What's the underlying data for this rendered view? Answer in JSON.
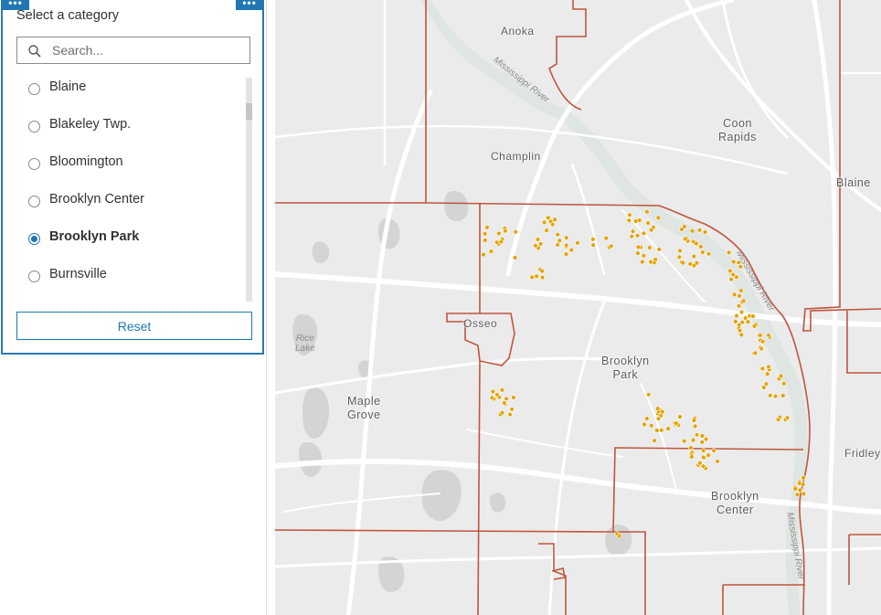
{
  "widget": {
    "title": "Select a category",
    "search_placeholder": "Search...",
    "options": [
      {
        "label": "Blaine",
        "checked": false
      },
      {
        "label": "Blakeley Twp.",
        "checked": false
      },
      {
        "label": "Bloomington",
        "checked": false
      },
      {
        "label": "Brooklyn Center",
        "checked": false
      },
      {
        "label": "Brooklyn Park",
        "checked": true
      },
      {
        "label": "Burnsville",
        "checked": false
      }
    ],
    "reset_label": "Reset",
    "handle_glyph": "•••"
  },
  "map": {
    "labels": {
      "anoka": "Anoka",
      "coon_rapids": "Coon\nRapids",
      "champlin": "Champlin",
      "blaine": "Blaine",
      "osseo": "Osseo",
      "rice_lake": "Rice\nLake",
      "maple_grove": "Maple\nGrove",
      "brooklyn_park": "Brooklyn\nPark",
      "fridley": "Fridley",
      "brooklyn_center": "Brooklyn\nCenter",
      "mississippi_river_1": "Mississippi River",
      "mississippi_river_2": "Mississippi River",
      "mississippi_river_3": "Mississippi River"
    },
    "colors": {
      "land": "#ebebeb",
      "water": "#d4d4d4",
      "river_fill": "#dfe6e2",
      "road": "#ffffff",
      "boundary": "#c0553d",
      "point": "#e2a400",
      "selection": "#1f77b4"
    }
  }
}
